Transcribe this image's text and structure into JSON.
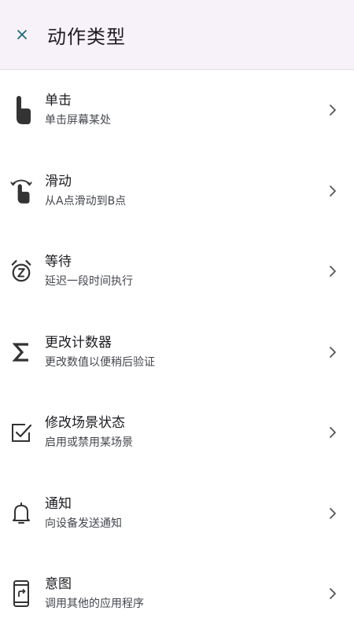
{
  "header": {
    "title": "动作类型",
    "close_icon": "close-icon"
  },
  "items": [
    {
      "label": "单击",
      "sub": "单击屏幕某处",
      "icon": "tap-gesture-icon"
    },
    {
      "label": "滑动",
      "sub": "从A点滑动到B点",
      "icon": "swipe-gesture-icon"
    },
    {
      "label": "等待",
      "sub": "延迟一段时间执行",
      "icon": "snooze-alarm-icon"
    },
    {
      "label": "更改计数器",
      "sub": "更改数值以便稍后验证",
      "icon": "sigma-icon"
    },
    {
      "label": "修改场景状态",
      "sub": "启用或禁用某场景",
      "icon": "checkbox-icon"
    },
    {
      "label": "通知",
      "sub": "向设备发送通知",
      "icon": "bell-icon"
    },
    {
      "label": "意图",
      "sub": "调用其他的应用程序",
      "icon": "phone-forward-icon"
    }
  ],
  "colors": {
    "header_bg": "#f7f2f9",
    "close_icon": "#1e6b78",
    "text_primary": "#1d1b20",
    "text_secondary": "#44474e",
    "icon": "#333333"
  }
}
